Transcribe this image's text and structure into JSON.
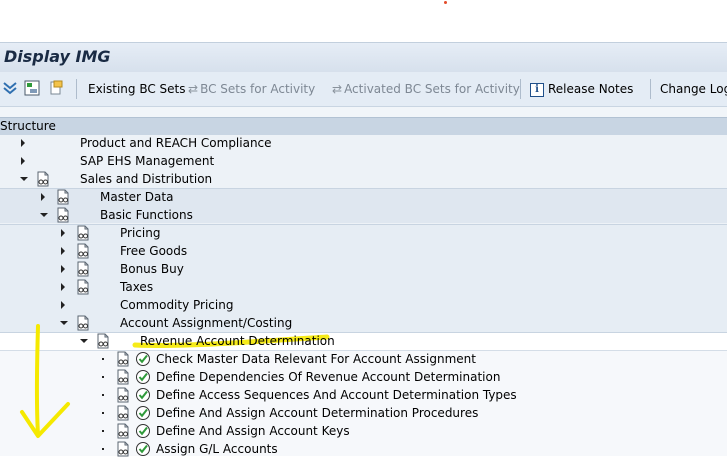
{
  "window": {
    "title": "Display IMG"
  },
  "toolbar": {
    "existing_bc_sets": "Existing BC Sets",
    "bc_sets_for_activity": "BC Sets for Activity",
    "activated_bc_sets": "Activated BC Sets for Activity",
    "release_notes": "Release Notes",
    "change_log": "Change Log"
  },
  "structure": {
    "header": "Structure",
    "items": [
      {
        "label": "Product and REACH Compliance",
        "level": 0,
        "expand": "collapsed",
        "icon": "none"
      },
      {
        "label": "SAP EHS Management",
        "level": 0,
        "expand": "collapsed",
        "icon": "none"
      },
      {
        "label": "Sales and Distribution",
        "level": 0,
        "expand": "expanded",
        "icon": "doc-glasses"
      },
      {
        "label": "Master Data",
        "level": 1,
        "expand": "collapsed",
        "icon": "doc-glasses"
      },
      {
        "label": "Basic Functions",
        "level": 1,
        "expand": "expanded",
        "icon": "doc-glasses"
      },
      {
        "label": "Pricing",
        "level": 2,
        "expand": "collapsed",
        "icon": "doc-glasses"
      },
      {
        "label": "Free Goods",
        "level": 2,
        "expand": "collapsed",
        "icon": "doc-glasses"
      },
      {
        "label": "Bonus Buy",
        "level": 2,
        "expand": "collapsed",
        "icon": "doc-glasses"
      },
      {
        "label": "Taxes",
        "level": 2,
        "expand": "collapsed",
        "icon": "doc-glasses"
      },
      {
        "label": "Commodity Pricing",
        "level": 2,
        "expand": "collapsed",
        "icon": "none"
      },
      {
        "label": "Account Assignment/Costing",
        "level": 2,
        "expand": "expanded",
        "icon": "doc-glasses"
      },
      {
        "label": "Revenue Account Determination",
        "level": 3,
        "expand": "expanded",
        "icon": "doc-glasses"
      },
      {
        "label": "Check Master Data Relevant For Account Assignment",
        "level": 4,
        "expand": "leaf",
        "icon": "doc-glasses-execute"
      },
      {
        "label": "Define Dependencies Of Revenue Account Determination",
        "level": 4,
        "expand": "leaf",
        "icon": "doc-glasses-execute"
      },
      {
        "label": "Define Access Sequences And Account Determination Types",
        "level": 4,
        "expand": "leaf",
        "icon": "doc-glasses-execute"
      },
      {
        "label": "Define And Assign Account Determination Procedures",
        "level": 4,
        "expand": "leaf",
        "icon": "doc-glasses-execute"
      },
      {
        "label": "Define And Assign Account Keys",
        "level": 4,
        "expand": "leaf",
        "icon": "doc-glasses-execute"
      },
      {
        "label": "Assign G/L Accounts",
        "level": 4,
        "expand": "leaf",
        "icon": "doc-glasses-execute"
      }
    ]
  },
  "colors": {
    "annotation": "#f5e900",
    "execute_icon": "#2f9a3a",
    "header_band": "#c8d5e3"
  }
}
